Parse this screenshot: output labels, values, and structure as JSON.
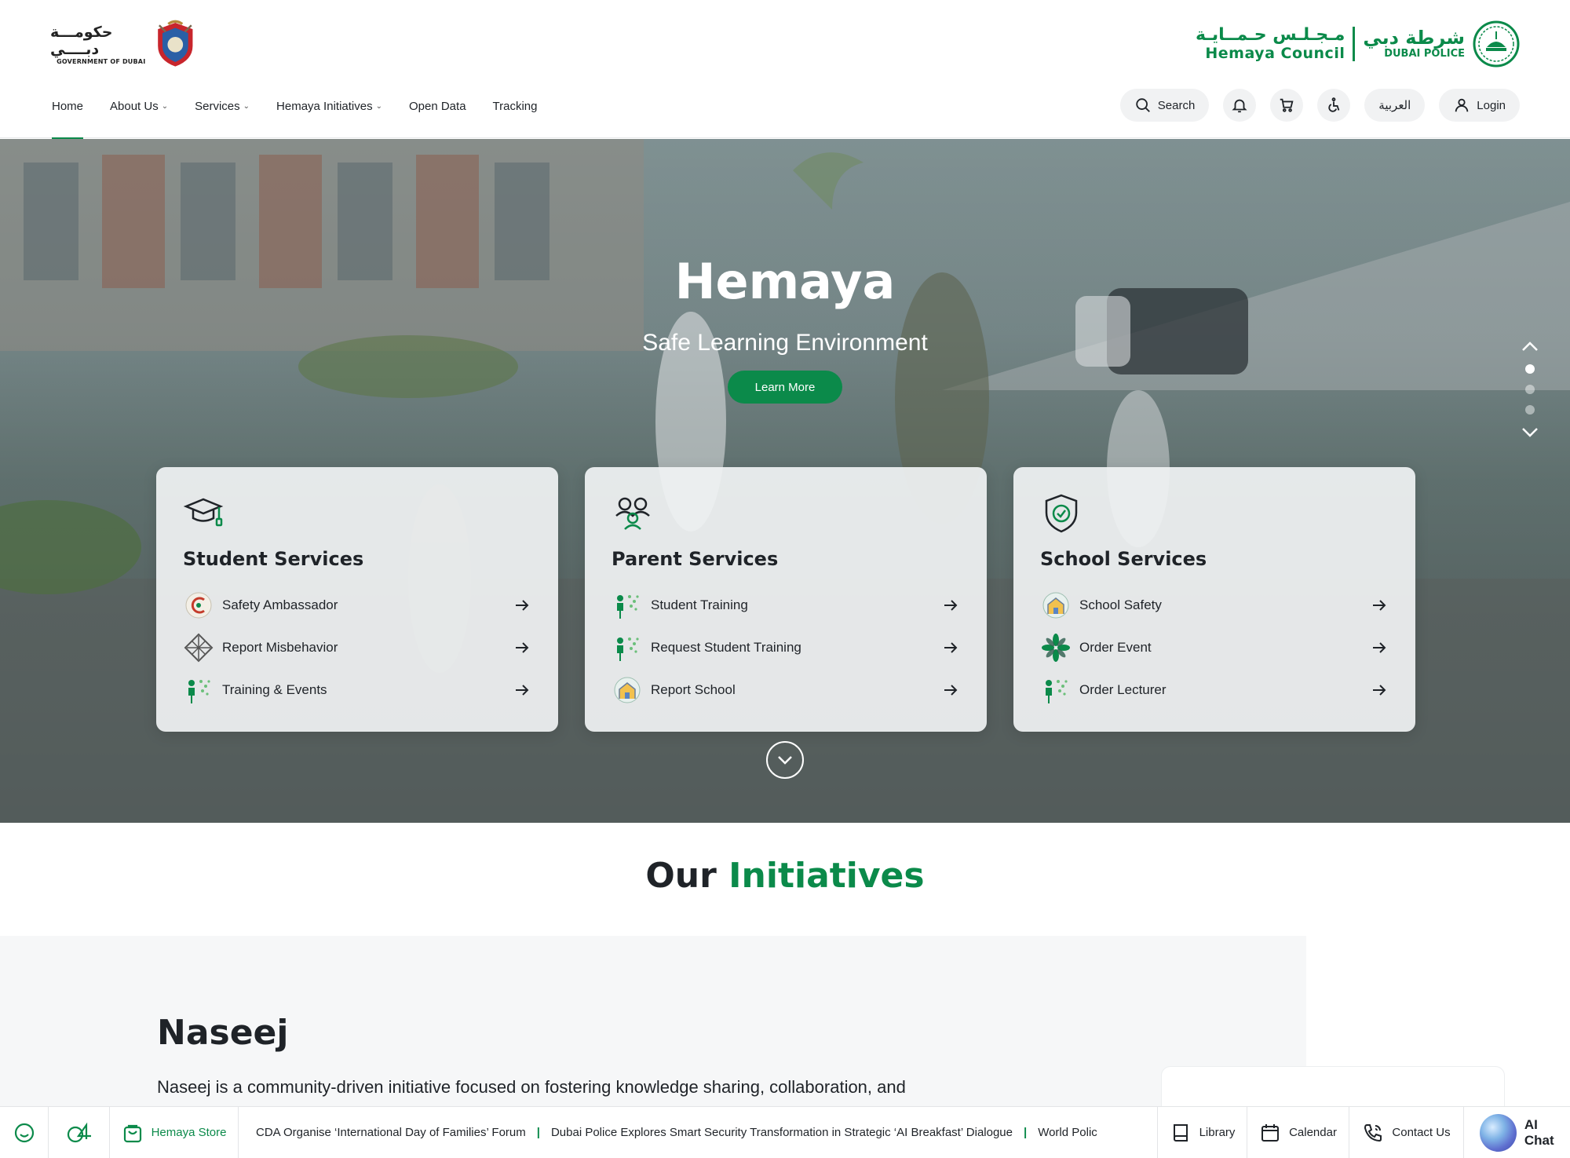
{
  "header": {
    "gov_logo_ar": "حكومـــة دبــــي",
    "gov_logo_en": "GOVERNMENT OF DUBAI",
    "council_ar": "مـجـلـس حـمــايـة",
    "council_en": "Hemaya Council",
    "police_ar": "شرطة دبي",
    "police_en": "DUBAI POLICE"
  },
  "nav": {
    "items": [
      {
        "label": "Home",
        "dropdown": false,
        "active": true
      },
      {
        "label": "About Us",
        "dropdown": true
      },
      {
        "label": "Services",
        "dropdown": true
      },
      {
        "label": "Hemaya Initiatives",
        "dropdown": true
      },
      {
        "label": "Open Data",
        "dropdown": false
      },
      {
        "label": "Tracking",
        "dropdown": false
      }
    ]
  },
  "tools": {
    "search_label": "Search",
    "language_label": "العربية",
    "login_label": "Login"
  },
  "hero": {
    "title": "Hemaya",
    "subtitle": "Safe Learning Environment",
    "cta_label": "Learn More",
    "slide_count": 3,
    "active_slide": 1
  },
  "cards": [
    {
      "title": "Student Services",
      "icon": "graduation-cap-icon",
      "items": [
        {
          "label": "Safety Ambassador",
          "icon": "safety-ambassador-icon"
        },
        {
          "label": "Report Misbehavior",
          "icon": "report-misbehavior-icon"
        },
        {
          "label": "Training & Events",
          "icon": "training-events-icon"
        }
      ]
    },
    {
      "title": "Parent Services",
      "icon": "parents-icon",
      "items": [
        {
          "label": "Student Training",
          "icon": "student-training-icon"
        },
        {
          "label": "Request Student Training",
          "icon": "request-training-icon"
        },
        {
          "label": "Report School",
          "icon": "report-school-icon"
        }
      ]
    },
    {
      "title": "School Services",
      "icon": "shield-check-icon",
      "items": [
        {
          "label": "School Safety",
          "icon": "school-safety-icon"
        },
        {
          "label": "Order Event",
          "icon": "order-event-icon"
        },
        {
          "label": "Order Lecturer",
          "icon": "order-lecturer-icon"
        }
      ]
    }
  ],
  "initiatives": {
    "heading_prefix": "Our",
    "heading_highlight": "Initiatives",
    "current_name": "Naseej",
    "current_description": "Naseej is a community-driven initiative focused on fostering knowledge sharing, collaboration, and"
  },
  "bottom_bar": {
    "store_label": "Hemaya Store",
    "news": [
      "CDA Organise ‘International Day of Families’ Forum",
      "Dubai Police Explores Smart Security Transformation in Strategic ‘AI Breakfast’ Dialogue",
      "World Polic"
    ],
    "library_label": "Library",
    "calendar_label": "Calendar",
    "contact_label": "Contact Us",
    "ai_label": "AI Chat"
  },
  "colors": {
    "brand_green": "#0b8a4a",
    "text_dark": "#1f2328",
    "panel_bg": "#f6f7f8"
  }
}
